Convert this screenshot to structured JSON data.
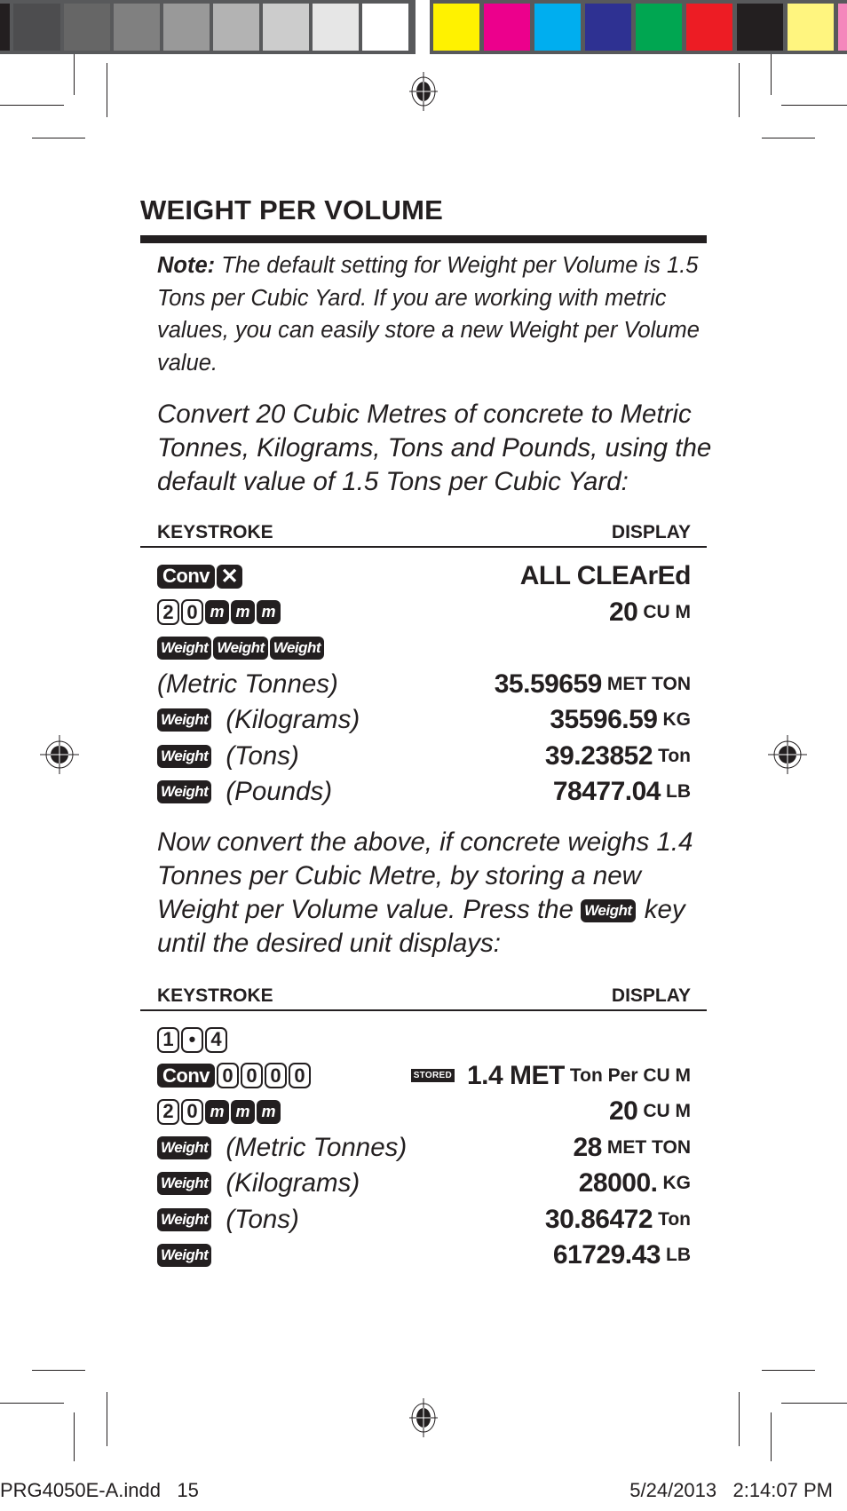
{
  "print_marks": {
    "gray_swatches": [
      "#231f20",
      "#4d4d4f",
      "#666666",
      "#808080",
      "#999999",
      "#b3b3b3",
      "#cccccc",
      "#e6e6e6",
      "#ffffff"
    ],
    "color_swatches": [
      "#fff200",
      "#ec008c",
      "#00aeef",
      "#2e3192",
      "#00a651",
      "#ed1c24",
      "#231f20",
      "#fff57f",
      "#f487bc"
    ]
  },
  "page": {
    "title": "WEIGHT PER VOLUME",
    "note_label": "Note:",
    "note_text": " The default setting for Weight per Volume is 1.5 Tons per Cubic Yard. If you are working with metric values, you can easily store a new Weight per Volume value.",
    "instruction1": "Convert 20 Cubic Metres of concrete to Metric Tonnes, Kilograms, Tons and Pounds, using the default value of 1.5 Tons per Cubic Yard:",
    "instruction2_part1": "Now convert the above, if concrete weighs 1.4 Tonnes per Cubic Metre, by storing a new Weight per Volume value. Press the ",
    "instruction2_key": "Weight",
    "instruction2_part2": " key until the desired unit displays:"
  },
  "table_headers": {
    "keystroke": "KEYSTROKE",
    "display": "DISPLAY"
  },
  "keys": {
    "conv": "Conv",
    "clear": "✕",
    "m": "m",
    "weight": "Weight",
    "dot": "•"
  },
  "table1": {
    "rows": [
      {
        "keys": [
          "Conv",
          "✕"
        ],
        "label": "",
        "value": "ALL CLEArEd",
        "unit": ""
      },
      {
        "keys": [
          "2",
          "0",
          "m",
          "m",
          "m"
        ],
        "label": "",
        "value": "20",
        "unit": "CU M"
      },
      {
        "keys": [
          "Weight",
          "Weight",
          "Weight"
        ],
        "label": "",
        "value": "",
        "unit": ""
      },
      {
        "keys": [],
        "label": "(Metric Tonnes)",
        "value": "35.59659",
        "unit": "MET TON"
      },
      {
        "keys": [
          "Weight"
        ],
        "label": "(Kilograms)",
        "value": "35596.59",
        "unit": "KG"
      },
      {
        "keys": [
          "Weight"
        ],
        "label": "(Tons)",
        "value": "39.23852",
        "unit": "Ton"
      },
      {
        "keys": [
          "Weight"
        ],
        "label": "(Pounds)",
        "value": "78477.04",
        "unit": "LB"
      }
    ]
  },
  "table2": {
    "rows": [
      {
        "keys": [
          "1",
          "•",
          "4"
        ],
        "label": "",
        "value": "",
        "unit": ""
      },
      {
        "keys": [
          "Conv",
          "0",
          "0",
          "0",
          "0"
        ],
        "label": "",
        "badge": "STORED",
        "value": "1.4 MET",
        "unit": "Ton Per CU M"
      },
      {
        "keys": [
          "2",
          "0",
          "m",
          "m",
          "m"
        ],
        "label": "",
        "value": "20",
        "unit": "CU M"
      },
      {
        "keys": [
          "Weight"
        ],
        "label": "(Metric Tonnes)",
        "value": "28",
        "unit": "MET TON"
      },
      {
        "keys": [
          "Weight"
        ],
        "label": "(Kilograms)",
        "value": "28000.",
        "unit": "KG"
      },
      {
        "keys": [
          "Weight"
        ],
        "label": "(Tons)",
        "value": "30.86472",
        "unit": "Ton"
      },
      {
        "keys": [
          "Weight"
        ],
        "label": "",
        "value": "61729.43",
        "unit": "LB"
      }
    ]
  },
  "footer": {
    "file": "PRG4050E-A.indd   15",
    "timestamp": "5/24/2013   2:14:07 PM"
  }
}
